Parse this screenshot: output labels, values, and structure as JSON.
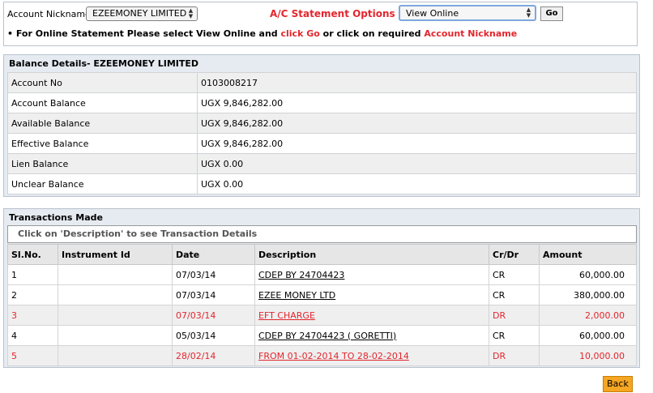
{
  "top": {
    "nickname_label": "Account Nickname",
    "nickname_value": "EZEEMONEY LIMITED",
    "options_label": "A/C Statement Options -->",
    "options_value": "View Online",
    "go_label": "Go",
    "note": {
      "bullet": "•",
      "part1": " For Online Statement Please select View Online and ",
      "part2": "click Go",
      "part3": " or click on required ",
      "part4": "Account Nickname"
    }
  },
  "balance": {
    "title": "Balance Details- EZEEMONEY LIMITED",
    "rows": [
      {
        "label": "Account No",
        "value": "0103008217"
      },
      {
        "label": "Account Balance",
        "value": "UGX 9,846,282.00"
      },
      {
        "label": "Available Balance",
        "value": "UGX 9,846,282.00"
      },
      {
        "label": "Effective Balance",
        "value": "UGX 9,846,282.00"
      },
      {
        "label": "Lien Balance",
        "value": "UGX 0.00"
      },
      {
        "label": "Unclear Balance",
        "value": "UGX 0.00"
      }
    ]
  },
  "transactions": {
    "title": "Transactions Made",
    "hint": "Click on 'Description' to see Transaction Details",
    "headers": [
      "Sl.No.",
      "Instrument Id",
      "Date",
      "Description",
      "Cr/Dr",
      "Amount"
    ],
    "rows": [
      {
        "sl": "1",
        "instrument": "",
        "date": "07/03/14",
        "desc": "CDEP BY 24704423",
        "crdr": "CR",
        "amount": "60,000.00"
      },
      {
        "sl": "2",
        "instrument": "",
        "date": "07/03/14",
        "desc": "EZEE MONEY LTD",
        "crdr": "CR",
        "amount": "380,000.00"
      },
      {
        "sl": "3",
        "instrument": "",
        "date": "07/03/14",
        "desc": "EFT CHARGE",
        "crdr": "DR",
        "amount": "2,000.00"
      },
      {
        "sl": "4",
        "instrument": "",
        "date": "05/03/14",
        "desc": "CDEP BY 24704423 ( GORETTI)",
        "crdr": "CR",
        "amount": "60,000.00"
      },
      {
        "sl": "5",
        "instrument": "",
        "date": "28/02/14",
        "desc": "FROM 01-02-2014 TO 28-02-2014",
        "crdr": "DR",
        "amount": "10,000.00"
      }
    ]
  },
  "back_label": "Back",
  "colors": {
    "accent_red": "#e3262d",
    "back_orange": "#f5a623",
    "panel_bg": "#e6ebf2"
  }
}
